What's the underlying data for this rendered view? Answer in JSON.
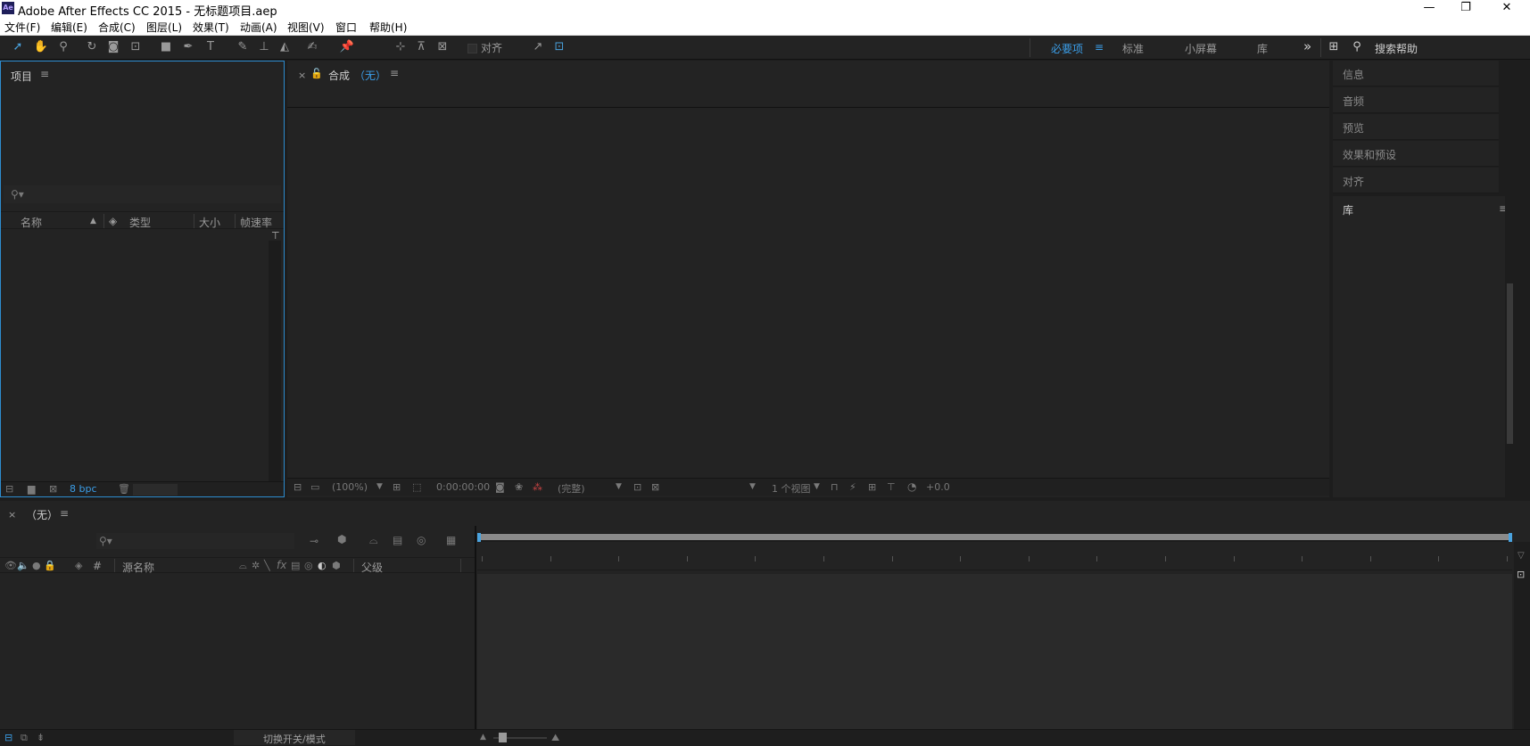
{
  "window": {
    "app_icon": "Ae",
    "title": "Adobe After Effects CC 2015 - 无标题项目.aep",
    "controls": [
      "—",
      "❐",
      "✕"
    ]
  },
  "menu": [
    "文件(F)",
    "编辑(E)",
    "合成(C)",
    "图层(L)",
    "效果(T)",
    "动画(A)",
    "视图(V)",
    "窗口",
    "帮助(H)"
  ],
  "toolbar": {
    "align_label": "对齐",
    "workspaces": [
      "必要项",
      "标准",
      "小屏幕",
      "库"
    ],
    "more": "»",
    "search_help": "搜索帮助"
  },
  "project_panel": {
    "title": "项目",
    "columns": [
      "名称",
      "类型",
      "大小",
      "帧速率"
    ],
    "bpc": "8 bpc"
  },
  "comp_panel": {
    "title": "合成",
    "comp_name": "（无）",
    "zoom": "(100%)",
    "timecode": "0:00:00:00",
    "resolution": "(完整)",
    "views": "1 个视图",
    "exposure": "+0.0"
  },
  "right_panels": {
    "items": [
      "信息",
      "音频",
      "预览",
      "效果和预设",
      "对齐"
    ],
    "library_title": "库"
  },
  "timeline": {
    "tab_name": "（无）",
    "columns": [
      "#",
      "源名称",
      "父级"
    ],
    "toggle_label": "切换开关/模式"
  },
  "colors": {
    "accent": "#3b9ee8",
    "panel_bg": "#232323",
    "app_bg": "#1d1d1d"
  }
}
